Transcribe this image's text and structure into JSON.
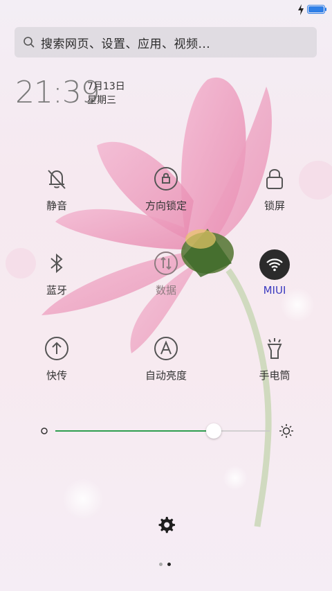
{
  "search": {
    "placeholder": "搜索网页、设置、应用、视频..."
  },
  "clock": {
    "time": "21:39",
    "date": "7月13日",
    "weekday": "星期三"
  },
  "tiles": [
    {
      "label": "静音",
      "icon": "mute-bell-icon"
    },
    {
      "label": "方向锁定",
      "icon": "rotation-lock-icon"
    },
    {
      "label": "锁屏",
      "icon": "lock-icon"
    },
    {
      "label": "蓝牙",
      "icon": "bluetooth-icon"
    },
    {
      "label": "数据",
      "icon": "mobile-data-icon"
    },
    {
      "label": "MIUI",
      "icon": "wifi-icon",
      "active": true
    },
    {
      "label": "快传",
      "icon": "quick-transfer-icon"
    },
    {
      "label": "自动亮度",
      "icon": "auto-brightness-icon"
    },
    {
      "label": "手电筒",
      "icon": "flashlight-icon"
    }
  ],
  "brightness": {
    "level": 0.74
  },
  "pager": {
    "count": 2,
    "active_index": 1
  },
  "colors": {
    "accent": "#3b3bbf",
    "slider": "#2e9e4f",
    "battery": "#2f7fe6"
  }
}
